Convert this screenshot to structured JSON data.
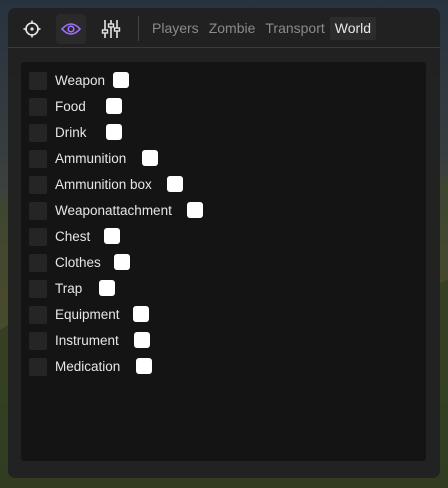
{
  "toolbar": {
    "icons": [
      "crosshair-icon",
      "eye-icon",
      "sliders-icon"
    ],
    "active_icon": "eye-icon",
    "accent_color": "#a271ff"
  },
  "tabs": [
    {
      "label": "Players",
      "active": false
    },
    {
      "label": "Zombie",
      "active": false
    },
    {
      "label": "Transport",
      "active": false
    },
    {
      "label": "World",
      "active": true
    }
  ],
  "items": [
    {
      "label": "Weapon",
      "checked": false,
      "color": "#ffffff"
    },
    {
      "label": "Food",
      "checked": false,
      "color": "#ffffff"
    },
    {
      "label": "Drink",
      "checked": false,
      "color": "#ffffff"
    },
    {
      "label": "Ammunition",
      "checked": false,
      "color": "#ffffff"
    },
    {
      "label": "Ammunition box",
      "checked": false,
      "color": "#ffffff"
    },
    {
      "label": "Weaponattachment",
      "checked": false,
      "color": "#ffffff"
    },
    {
      "label": "Chest",
      "checked": false,
      "color": "#ffffff"
    },
    {
      "label": "Clothes",
      "checked": false,
      "color": "#ffffff"
    },
    {
      "label": "Trap",
      "checked": false,
      "color": "#ffffff"
    },
    {
      "label": "Equipment",
      "checked": false,
      "color": "#ffffff"
    },
    {
      "label": "Instrument",
      "checked": false,
      "color": "#ffffff"
    },
    {
      "label": "Medication",
      "checked": false,
      "color": "#ffffff"
    }
  ]
}
